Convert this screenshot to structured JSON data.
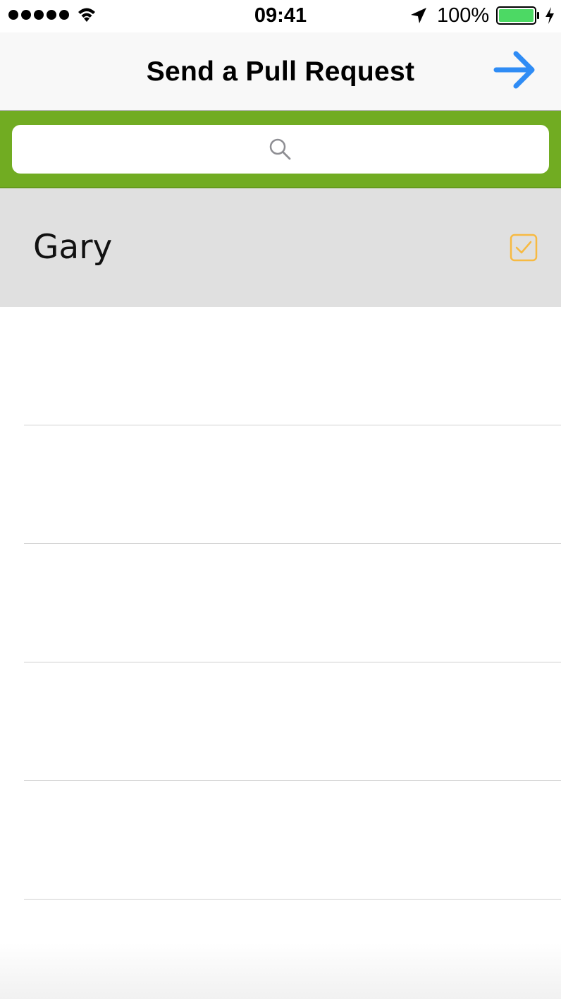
{
  "status_bar": {
    "signal_icon": "signal-dots-icon",
    "wifi_icon": "wifi-icon",
    "time": "09:41",
    "location_icon": "location-arrow-icon",
    "battery_percent": "100%",
    "battery_icon": "battery-icon",
    "charging_icon": "charging-bolt-icon",
    "battery_color": "#4cd964"
  },
  "nav": {
    "title": "Send a Pull Request",
    "next_icon": "arrow-right-icon",
    "accent_color": "#2f8cf5"
  },
  "search": {
    "background_color": "#71ac22",
    "search_icon": "search-icon",
    "value": ""
  },
  "list": {
    "items": [
      {
        "name": "Gary",
        "selected": true,
        "checkbox_icon": "checked-checkbox-icon",
        "checkbox_color": "#f7ba42"
      }
    ]
  }
}
